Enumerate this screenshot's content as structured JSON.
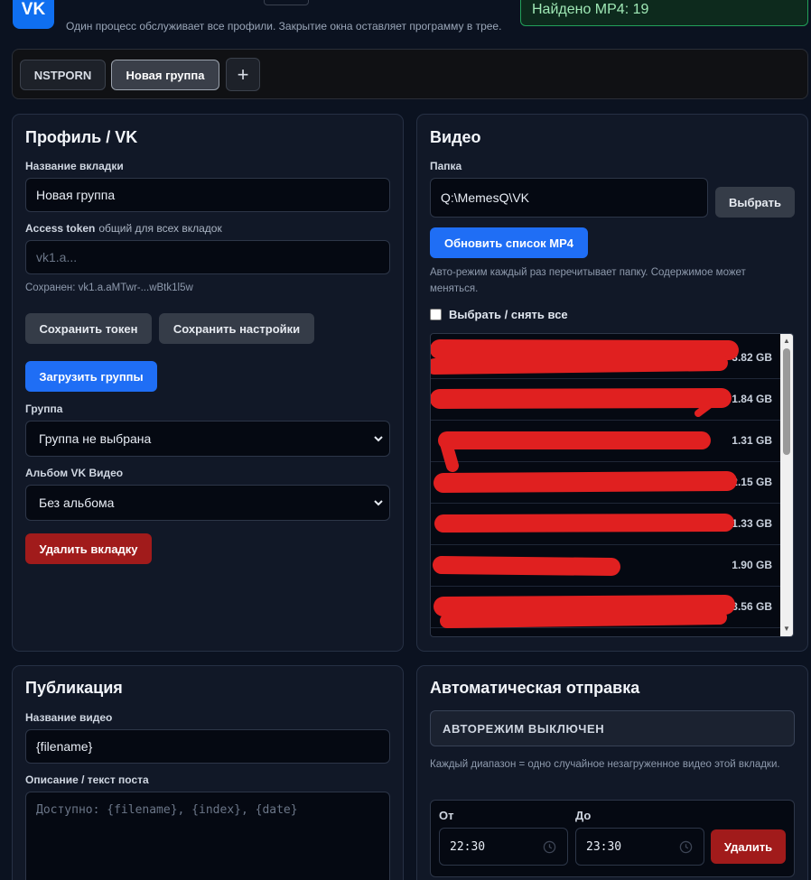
{
  "header": {
    "logo_text": "VK",
    "subtitle": "Один процесс обслуживает все профили. Закрытие окна оставляет программу в трее.",
    "counter": "Найдено MP4: 19"
  },
  "tabs": [
    {
      "label": "NSTPORN",
      "active": false
    },
    {
      "label": "Новая группа",
      "active": true
    }
  ],
  "add_tab_label": "+",
  "profile": {
    "title": "Профиль / VK",
    "tab_name_label": "Название вкладки",
    "tab_name_value": "Новая группа",
    "token_label": "Access token",
    "token_sublabel": "общий для всех вкладок",
    "token_placeholder": "vk1.a...",
    "token_saved": "Сохранен: vk1.a.aMTwr-...wBtk1l5w",
    "save_token": "Сохранить токен",
    "save_settings": "Сохранить настройки",
    "load_groups": "Загрузить группы",
    "group_label": "Группа",
    "group_value": "Группа не выбрана",
    "album_label": "Альбом VK Видео",
    "album_value": "Без альбома",
    "delete_tab": "Удалить вкладку"
  },
  "video": {
    "title": "Видео",
    "folder_label": "Папка",
    "folder_value": "Q:\\MemesQ\\VK",
    "choose": "Выбрать",
    "refresh": "Обновить список MP4",
    "hint": "Авто-режим каждый раз перечитывает папку. Содержимое может меняться.",
    "select_all": "Выбрать / снять все",
    "files": [
      {
        "size": "3.82 GB"
      },
      {
        "size": "1.84 GB"
      },
      {
        "size": "1.31 GB"
      },
      {
        "size": "2.15 GB"
      },
      {
        "size": "1.33 GB"
      },
      {
        "size": "1.90 GB"
      },
      {
        "size": "3.56 GB"
      }
    ],
    "redaction_color": "#e02020"
  },
  "publish": {
    "title": "Публикация",
    "video_name_label": "Название видео",
    "video_name_value": "{filename}",
    "desc_label": "Описание / текст поста",
    "desc_placeholder": "Доступно: {filename}, {index}, {date}"
  },
  "auto": {
    "title": "Автоматическая отправка",
    "status": "АВТОРЕЖИМ ВЫКЛЮЧЕН",
    "hint": "Каждый диапазон = одно случайное незагруженное видео этой вкладки.",
    "from_label": "От",
    "to_label": "До",
    "from_value": "22:30",
    "to_value": "23:30",
    "delete": "Удалить"
  }
}
